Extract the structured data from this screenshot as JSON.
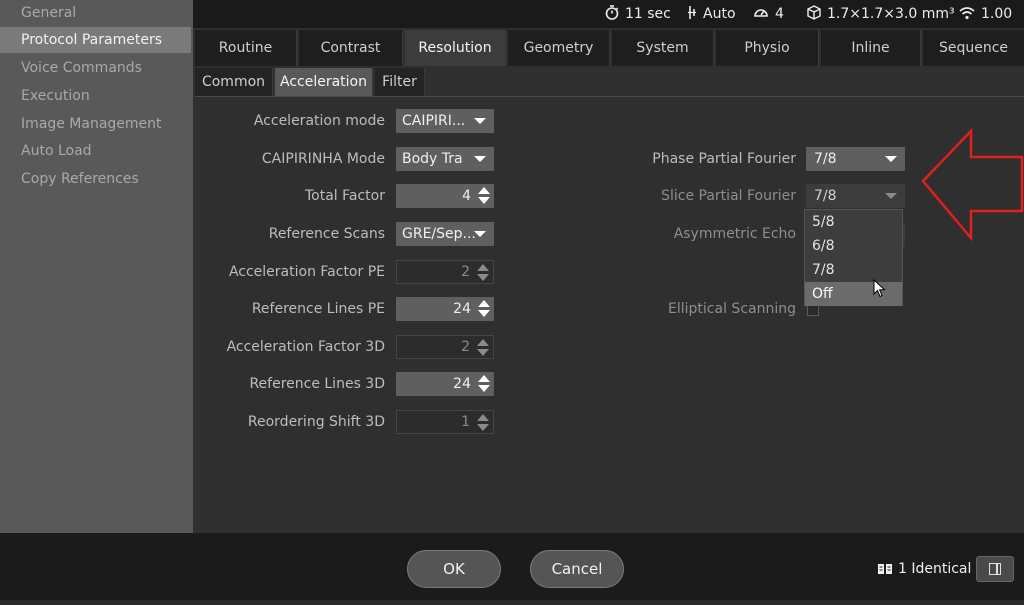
{
  "sidebar": {
    "items": [
      {
        "label": "General",
        "active": false
      },
      {
        "label": "Protocol Parameters",
        "active": true
      },
      {
        "label": "Voice Commands",
        "active": false
      },
      {
        "label": "Execution",
        "active": false
      },
      {
        "label": "Image Management",
        "active": false
      },
      {
        "label": "Auto Load",
        "active": false
      },
      {
        "label": "Copy References",
        "active": false
      }
    ]
  },
  "status": {
    "time": "11 sec",
    "mode": "Auto",
    "count": "4",
    "voxel": "1.7×1.7×3.0 mm³",
    "snr": "1.00"
  },
  "tabs": [
    "Routine",
    "Contrast",
    "Resolution",
    "Geometry",
    "System",
    "Physio",
    "Inline",
    "Sequence"
  ],
  "active_tab": "Resolution",
  "subtabs": [
    "Common",
    "Acceleration",
    "Filter"
  ],
  "active_subtab": "Acceleration",
  "left_params": {
    "acceleration_mode": {
      "label": "Acceleration mode",
      "value": "CAIPIRI..."
    },
    "caipirinha_mode": {
      "label": "CAIPIRINHA Mode",
      "value": "Body Tra"
    },
    "total_factor": {
      "label": "Total Factor",
      "value": "4"
    },
    "reference_scans": {
      "label": "Reference Scans",
      "value": "GRE/Sep..."
    },
    "acceleration_factor_pe": {
      "label": "Acceleration Factor PE",
      "value": "2"
    },
    "reference_lines_pe": {
      "label": "Reference Lines PE",
      "value": "24"
    },
    "acceleration_factor_3d": {
      "label": "Acceleration Factor 3D",
      "value": "2"
    },
    "reference_lines_3d": {
      "label": "Reference Lines 3D",
      "value": "24"
    },
    "reordering_shift_3d": {
      "label": "Reordering Shift 3D",
      "value": "1"
    }
  },
  "right_params": {
    "phase_partial_fourier": {
      "label": "Phase Partial Fourier",
      "value": "7/8"
    },
    "slice_partial_fourier": {
      "label": "Slice Partial Fourier",
      "value": "7/8"
    },
    "asymmetric_echo": {
      "label": "Asymmetric Echo"
    },
    "elliptical_scanning": {
      "label": "Elliptical Scanning",
      "checked": false
    }
  },
  "dropdown": {
    "options": [
      "5/8",
      "6/8",
      "7/8",
      "Off"
    ],
    "hovered": "Off"
  },
  "footer": {
    "ok_label": "OK",
    "cancel_label": "Cancel",
    "identical_label": "1 Identical"
  },
  "colors": {
    "annotation_arrow": "#e0201b",
    "panel_bg": "#2f2f2f",
    "sidebar_bg": "#595959"
  }
}
